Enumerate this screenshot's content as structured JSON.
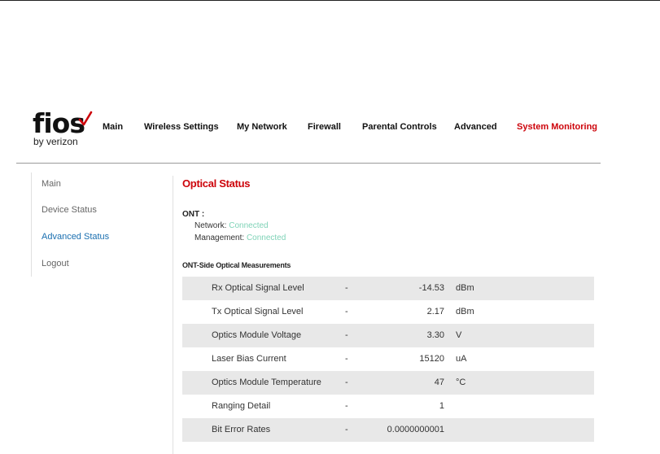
{
  "logo": {
    "wordmark": "fios",
    "sub": "by verizon",
    "accent_color": "#cd040b"
  },
  "topnav": {
    "items": [
      {
        "label": "Main"
      },
      {
        "label": "Wireless Settings"
      },
      {
        "label": "My Network"
      },
      {
        "label": "Firewall"
      },
      {
        "label": "Parental Controls"
      },
      {
        "label": "Advanced"
      },
      {
        "label": "System Monitoring",
        "active": true
      }
    ]
  },
  "sidebar": {
    "items": [
      {
        "label": "Main"
      },
      {
        "label": "Device Status"
      },
      {
        "label": "Advanced Status",
        "active": true
      },
      {
        "label": "Logout"
      }
    ]
  },
  "main": {
    "title": "Optical Status",
    "ont": {
      "label": "ONT :",
      "network_label": "Network:",
      "network_value": "Connected",
      "management_label": "Management:",
      "management_value": "Connected"
    },
    "section_title": "ONT-Side Optical Measurements",
    "rows": [
      {
        "name": "Rx Optical Signal Level",
        "dash": "-",
        "value": "-14.53",
        "unit": "dBm"
      },
      {
        "name": "Tx Optical Signal Level",
        "dash": "-",
        "value": "2.17",
        "unit": "dBm"
      },
      {
        "name": "Optics Module Voltage",
        "dash": "-",
        "value": "3.30",
        "unit": "V"
      },
      {
        "name": "Laser Bias Current",
        "dash": "-",
        "value": "15120",
        "unit": "uA"
      },
      {
        "name": "Optics Module Temperature",
        "dash": "-",
        "value": "47",
        "unit": "°C"
      },
      {
        "name": "Ranging Detail",
        "dash": "-",
        "value": "1",
        "unit": ""
      },
      {
        "name": "Bit Error Rates",
        "dash": "-",
        "value": "0.0000000001",
        "unit": ""
      }
    ]
  },
  "colors": {
    "accent": "#cd040b",
    "link_active": "#1a6fb0",
    "connected": "#7fd3b7",
    "row_shade": "#e8e8e8"
  }
}
